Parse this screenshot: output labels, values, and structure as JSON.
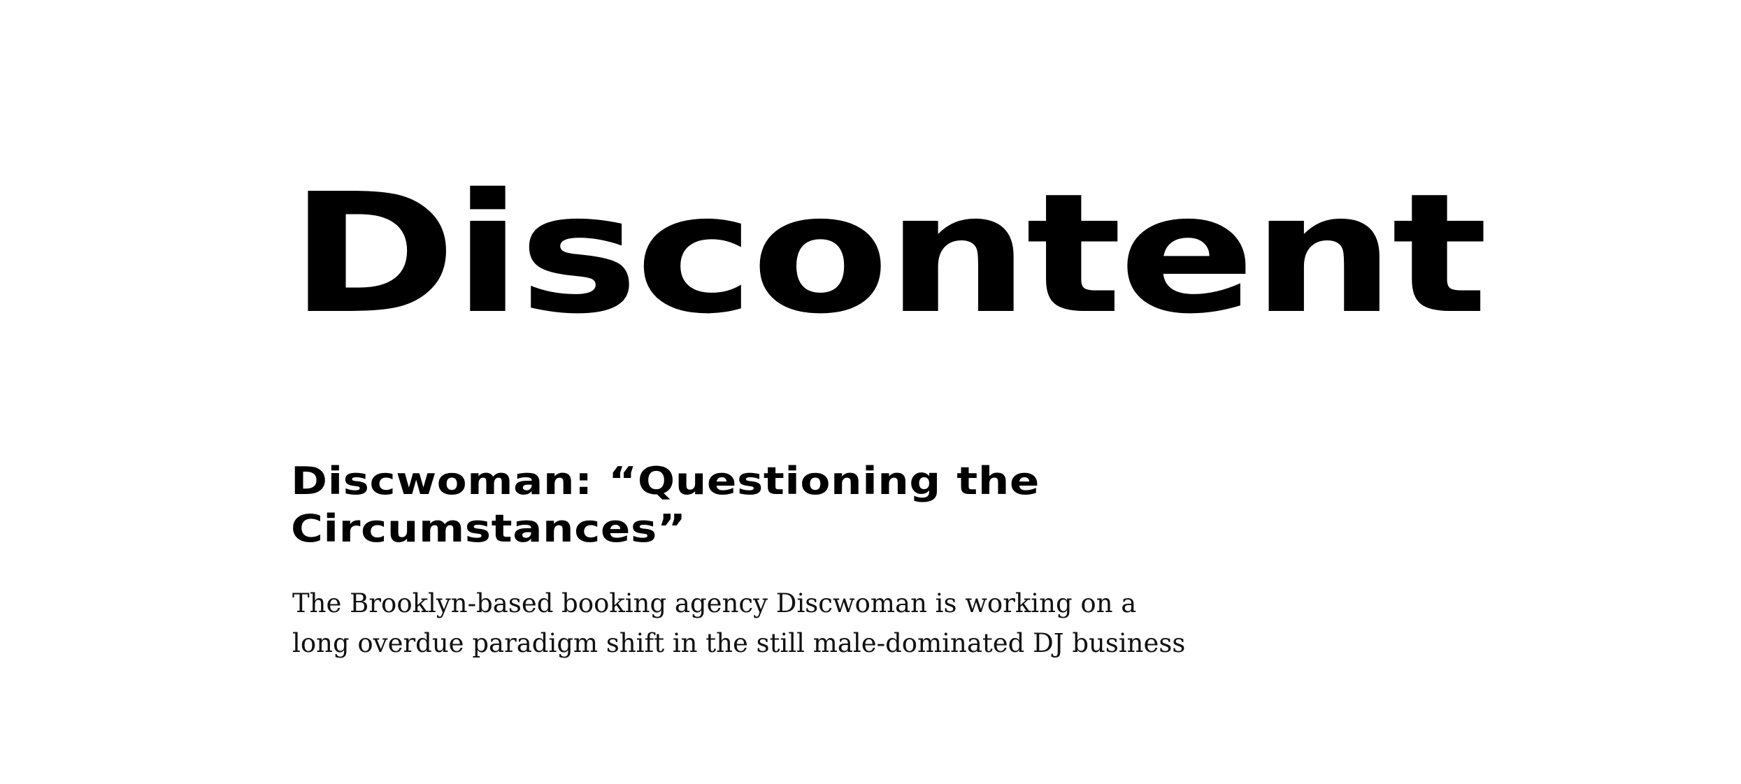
{
  "section": {
    "title": "Discontent"
  },
  "article": {
    "title": "Discwoman: “Questioning the Circumstances”",
    "summary": "The Brooklyn-based booking agency Discwoman is working on a long overdue paradigm shift in the still male-dominated DJ business"
  }
}
